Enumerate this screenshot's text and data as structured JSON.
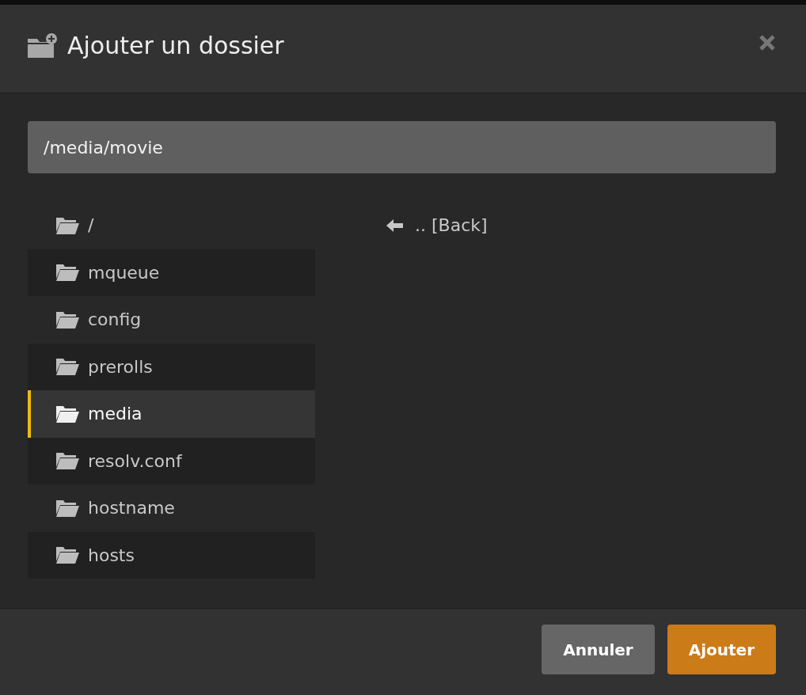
{
  "dialog": {
    "title": "Ajouter un dossier"
  },
  "path_field": {
    "value": "/media/movie"
  },
  "folders": [
    {
      "name": "/",
      "selected": false
    },
    {
      "name": "mqueue",
      "selected": false
    },
    {
      "name": "config",
      "selected": false
    },
    {
      "name": "prerolls",
      "selected": false
    },
    {
      "name": "media",
      "selected": true
    },
    {
      "name": "resolv.conf",
      "selected": false
    },
    {
      "name": "hostname",
      "selected": false
    },
    {
      "name": "hosts",
      "selected": false
    }
  ],
  "subfolders": [
    {
      "name": ".. [Back]",
      "kind": "back"
    }
  ],
  "buttons": [
    {
      "label": "Annuler",
      "kind": "secondary"
    },
    {
      "label": "Ajouter",
      "kind": "primary"
    }
  ]
}
